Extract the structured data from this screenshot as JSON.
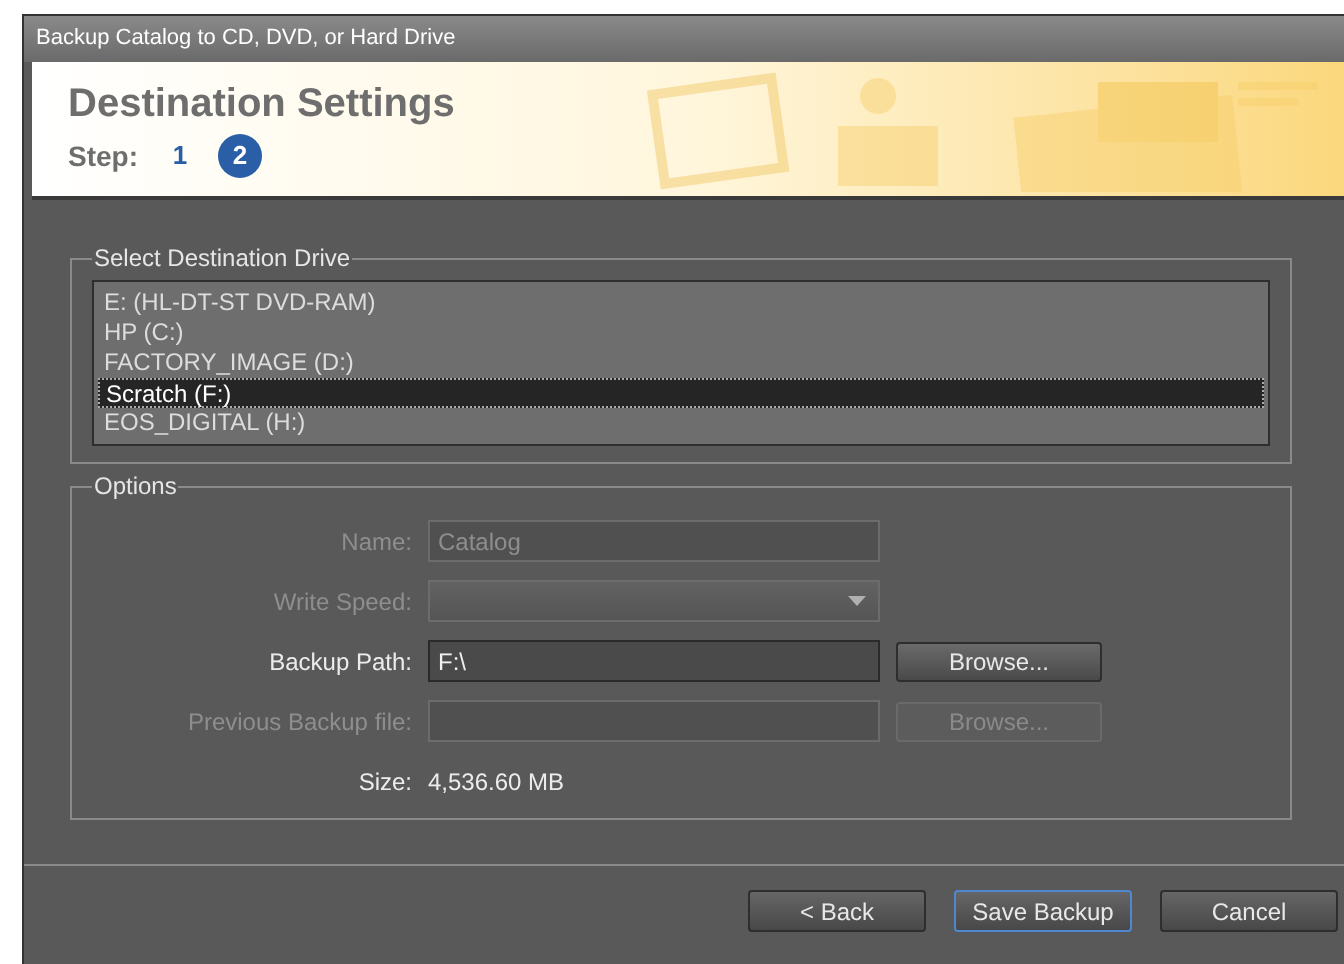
{
  "window": {
    "title": "Backup Catalog to CD, DVD, or Hard Drive"
  },
  "header": {
    "title": "Destination Settings",
    "step_label": "Step:",
    "steps": [
      {
        "label": "1",
        "selected": false
      },
      {
        "label": "2",
        "selected": true
      }
    ]
  },
  "drive_group": {
    "label": "Select Destination Drive",
    "drives": [
      {
        "label": "E: (HL-DT-ST DVD-RAM)",
        "selected": false
      },
      {
        "label": "HP (C:)",
        "selected": false
      },
      {
        "label": "FACTORY_IMAGE (D:)",
        "selected": false
      },
      {
        "label": "Scratch (F:)",
        "selected": true
      },
      {
        "label": "EOS_DIGITAL (H:)",
        "selected": false
      }
    ]
  },
  "options": {
    "label": "Options",
    "rows": [
      {
        "kind": "text",
        "label": "Name:",
        "value": "Catalog",
        "disabled": true
      },
      {
        "kind": "dropdown",
        "label": "Write Speed:",
        "disabled": true
      },
      {
        "kind": "text",
        "label": "Backup Path:",
        "value": "F:\\",
        "disabled": false,
        "button": {
          "label": "Browse...",
          "disabled": false
        }
      },
      {
        "kind": "text",
        "label": "Previous Backup file:",
        "disabled": true,
        "button": {
          "label": "Browse...",
          "disabled": true
        }
      },
      {
        "kind": "info",
        "label": "Size:",
        "value": "4,536.60 MB"
      }
    ]
  },
  "buttons": [
    {
      "label": "< Back",
      "default": false
    },
    {
      "label": "Save Backup",
      "default": true
    },
    {
      "label": "Cancel",
      "default": false
    }
  ]
}
